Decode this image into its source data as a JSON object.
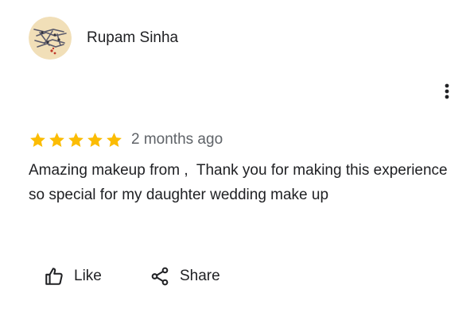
{
  "review": {
    "author_name": "Rupam Sinha",
    "rating": 5,
    "max_rating": 5,
    "time_ago": "2 months ago",
    "text": "Amazing makeup from ,  Thank you for making this experience so special for my daughter wedding make up"
  },
  "actions": {
    "like_label": "Like",
    "share_label": "Share"
  },
  "icons": {
    "avatar": "profile-photo-avatar",
    "menu": "more-vert-icon",
    "star": "star-icon",
    "like": "thumb-up-icon",
    "share": "share-icon"
  },
  "colors": {
    "star": "#fbbc04",
    "text": "#202124",
    "secondary_text": "#5f6368",
    "avatar_background": "#f1dfb8"
  }
}
